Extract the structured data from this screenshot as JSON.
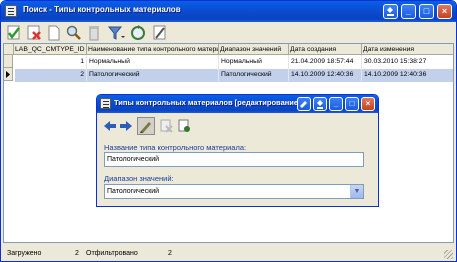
{
  "window": {
    "title": "Поиск - Типы контрольных материалов"
  },
  "toolbar": {
    "icons": [
      "new-record-check-icon",
      "delete-record-icon",
      "new-document-icon",
      "search-icon",
      "recycle-bin-icon",
      "filter-icon",
      "refresh-icon",
      "edit-icon"
    ]
  },
  "grid": {
    "columns": [
      "LAB_QC_CMTYPE_ID",
      "Наименование типа контрольного материала",
      "Диапазон значений",
      "Дата создания",
      "Дата изменения"
    ],
    "rows": [
      {
        "id": "1",
        "name": "Нормальный",
        "range": "Нормальный",
        "created": "21.04.2009 18:57:44",
        "changed": "30.03.2010 15:38:27"
      },
      {
        "id": "2",
        "name": "Патологический",
        "range": "Патологический",
        "created": "14.10.2009 12:40:36",
        "changed": "14.10.2009 12:40:36"
      }
    ]
  },
  "status": {
    "loaded_label": "Загружено",
    "loaded_count": "2",
    "filtered_label": "Отфильтровано",
    "filtered_count": "2"
  },
  "dialog": {
    "title": "Типы контрольных материалов [редактирование]",
    "name_label": "Название типа контрольного материала:",
    "name_value": "Патологический",
    "range_label": "Диапазон значений:",
    "range_value": "Патологический"
  },
  "colors": {
    "accent": "#0A4FD4",
    "selection": "#C2D0EC",
    "label": "#1A3C9E"
  }
}
